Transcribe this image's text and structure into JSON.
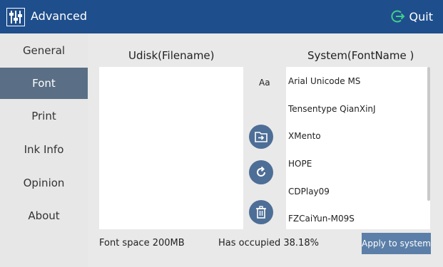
{
  "window": {
    "title": "Advanced",
    "quit_label": "Quit",
    "accent_color": "#1f4e8c",
    "app_icon": "sliders-icon",
    "quit_icon": "exit-arrow-icon"
  },
  "sidebar": {
    "items": [
      {
        "label": "General",
        "active": false
      },
      {
        "label": "Font",
        "active": true
      },
      {
        "label": "Print",
        "active": false
      },
      {
        "label": "Ink Info",
        "active": false
      },
      {
        "label": "Opinion",
        "active": false
      },
      {
        "label": "About",
        "active": false
      }
    ]
  },
  "main": {
    "udisk_title": "Udisk(Filename)",
    "system_title": "System(FontName )",
    "preview_label": "Aa",
    "fonts": [
      "Arial Unicode MS",
      "Tensentype QianXinJ",
      "XMento",
      "HOPE",
      "CDPlay09",
      "FZCaiYun-M09S"
    ],
    "actions": [
      "import-folder-icon",
      "refresh-icon",
      "trash-icon"
    ]
  },
  "footer": {
    "font_space": "Font space  200MB",
    "occupied": "Has occupied  38.18%",
    "apply_label": "Apply to system"
  }
}
